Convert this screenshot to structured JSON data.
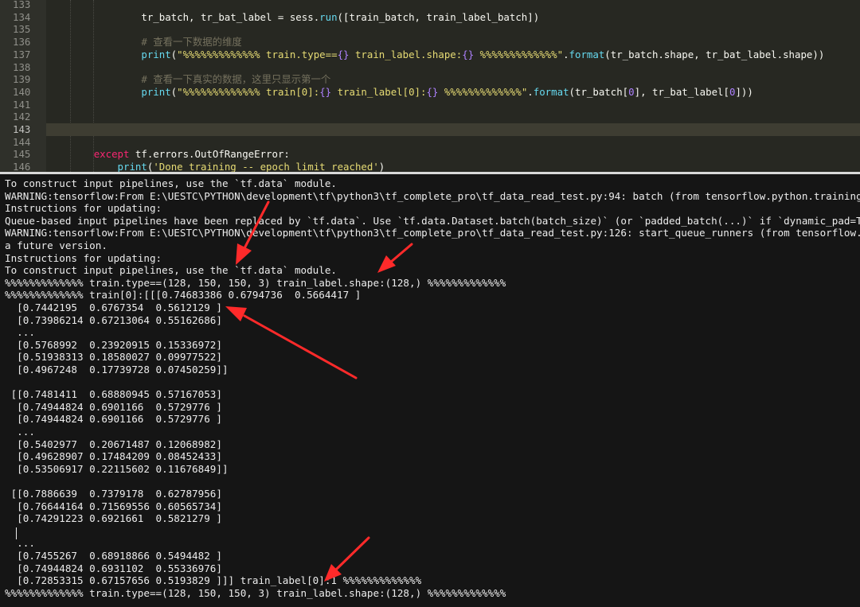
{
  "editor": {
    "lines": [
      {
        "num": "133",
        "code": ""
      },
      {
        "num": "134",
        "code": "                tr_batch, tr_bat_label = sess.run([train_batch, train_label_batch])"
      },
      {
        "num": "135",
        "code": ""
      },
      {
        "num": "136",
        "code": "                # 查看一下数据的维度"
      },
      {
        "num": "137",
        "code": "                print(\"%%%%%%%%%%%%% train.type=={} train_label.shape:{} %%%%%%%%%%%%%\".format(tr_batch.shape, tr_bat_label.shape))"
      },
      {
        "num": "138",
        "code": ""
      },
      {
        "num": "139",
        "code": "                # 查看一下真实的数据，这里只显示第一个"
      },
      {
        "num": "140",
        "code": "                print(\"%%%%%%%%%%%%% train[0]:{} train_label[0]:{} %%%%%%%%%%%%%\".format(tr_batch[0], tr_bat_label[0]))"
      },
      {
        "num": "141",
        "code": ""
      },
      {
        "num": "142",
        "code": ""
      },
      {
        "num": "143",
        "code": ""
      },
      {
        "num": "144",
        "code": ""
      },
      {
        "num": "145",
        "code": "        except tf.errors.OutOfRangeError:"
      },
      {
        "num": "146",
        "code": "            print('Done training -- epoch limit reached')"
      }
    ],
    "current_line_index": 10
  },
  "console": {
    "lines": [
      "To construct input pipelines, use the `tf.data` module.",
      "WARNING:tensorflow:From E:\\UESTC\\PYTHON\\development\\tf\\python3\\tf_complete_pro\\tf_data_read_test.py:94: batch (from tensorflow.python.training.input",
      "Instructions for updating:",
      "Queue-based input pipelines have been replaced by `tf.data`. Use `tf.data.Dataset.batch(batch_size)` (or `padded_batch(...)` if `dynamic_pad=True`)",
      "WARNING:tensorflow:From E:\\UESTC\\PYTHON\\development\\tf\\python3\\tf_complete_pro\\tf_data_read_test.py:126: start_queue_runners (from tensorflow.pytho",
      "a future version.",
      "Instructions for updating:",
      "To construct input pipelines, use the `tf.data` module.",
      "%%%%%%%%%%%%% train.type==(128, 150, 150, 3) train_label.shape:(128,) %%%%%%%%%%%%%",
      "%%%%%%%%%%%%% train[0]:[[[0.74683386 0.6794736  0.5664417 ]",
      "  [0.7442195  0.6767354  0.5612129 ]",
      "  [0.73986214 0.67213064 0.55162686]",
      "  ...",
      "  [0.5768992  0.23920915 0.15336972]",
      "  [0.51938313 0.18580027 0.09977522]",
      "  [0.4967248  0.17739728 0.07450259]]",
      "",
      " [[0.7481411  0.68880945 0.57167053]",
      "  [0.74944824 0.6901166  0.5729776 ]",
      "  [0.74944824 0.6901166  0.5729776 ]",
      "  ...",
      "  [0.5402977  0.20671487 0.12068982]",
      "  [0.49628907 0.17484209 0.08452433]",
      "  [0.53506917 0.22115602 0.11676849]]",
      "",
      " [[0.7886639  0.7379178  0.62787956]",
      "  [0.76644164 0.71569556 0.60565734]",
      "  [0.74291223 0.6921661  0.5821279 ]",
      "",
      "  ...",
      "  [0.7455267  0.68918866 0.5494482 ]",
      "  [0.74944824 0.6931102  0.55336976]",
      "  [0.72853315 0.67157656 0.5193829 ]]] train_label[0]:1 %%%%%%%%%%%%%",
      "%%%%%%%%%%%%% train.type==(128, 150, 150, 3) train_label.shape:(128,) %%%%%%%%%%%%%"
    ]
  },
  "colors": {
    "editor_bg": "#272822",
    "console_bg": "#151515",
    "annotation_arrow": "#ff2a2a"
  },
  "annotations": {
    "arrow_count": 4,
    "arrow_icon": "red-arrow-icon"
  }
}
